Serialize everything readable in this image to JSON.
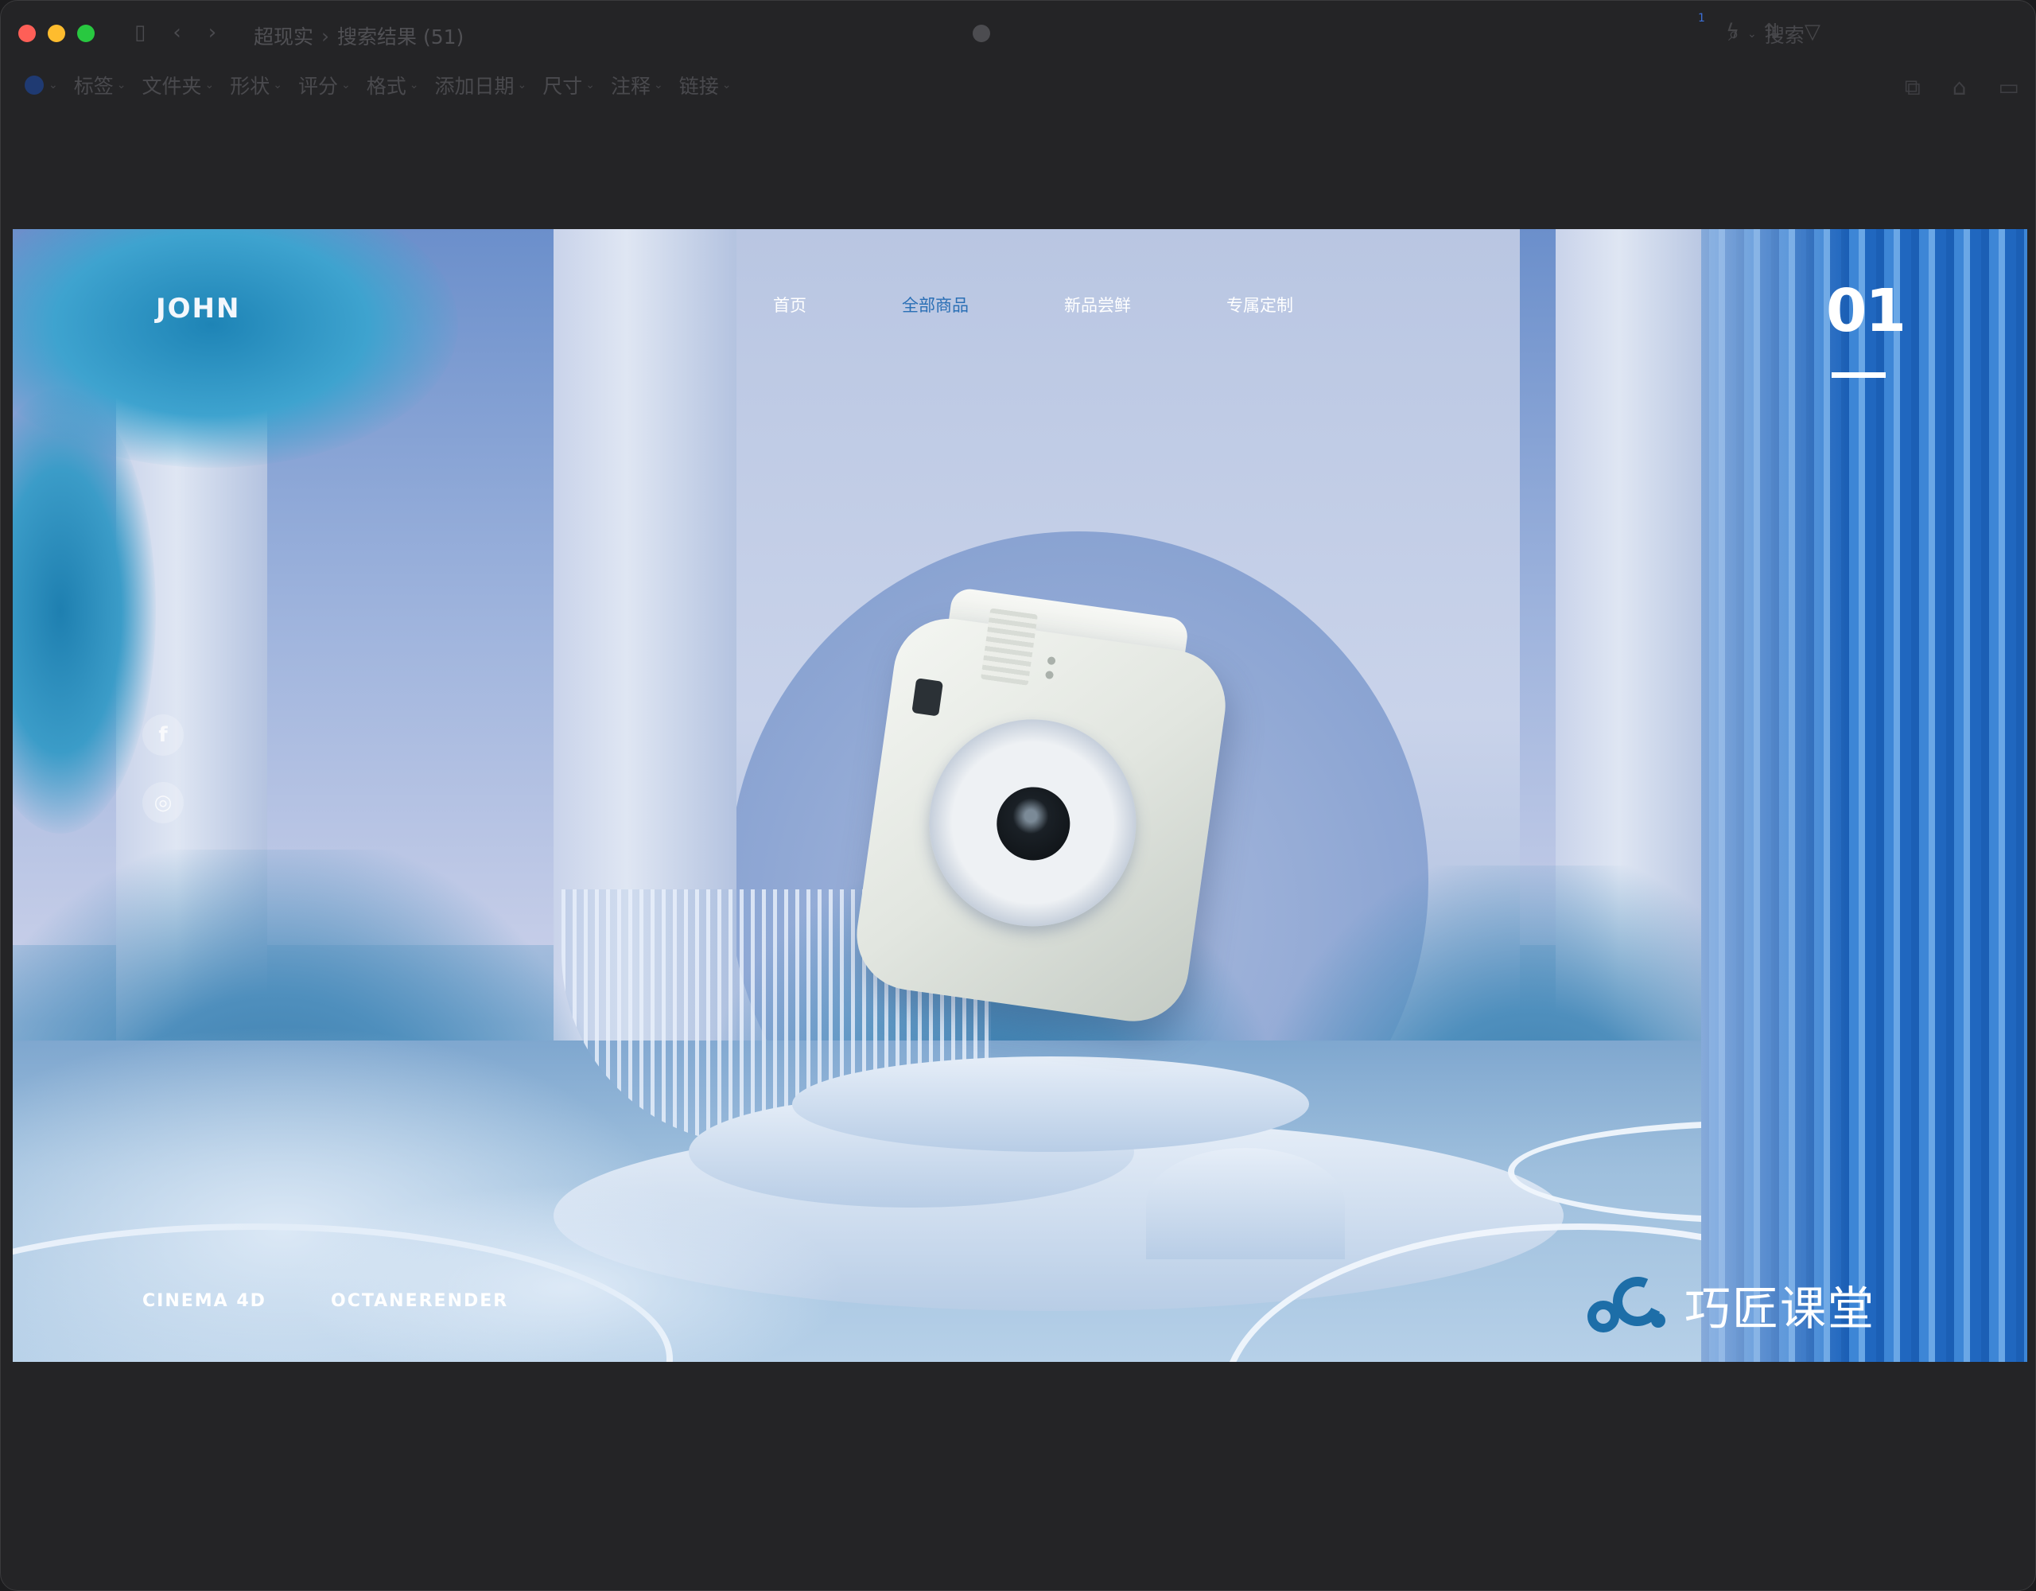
{
  "window": {
    "breadcrumb": [
      "超现实",
      "搜索结果 (51)"
    ],
    "search_placeholder": "搜索",
    "notification_count": "1"
  },
  "toolbar": {
    "filters": [
      "标签",
      "文件夹",
      "形状",
      "评分",
      "格式",
      "添加日期",
      "尺寸",
      "注释",
      "链接"
    ]
  },
  "artwork": {
    "logo": "JOHN",
    "nav": [
      "首页",
      "全部商品",
      "新品尝鲜",
      "专属定制"
    ],
    "active_nav": "全部商品",
    "page_number": "01",
    "social": [
      "f",
      "◎"
    ],
    "tags": [
      "CINEMA 4D",
      "OCTANERENDER"
    ],
    "brand_name": "巧匠课堂",
    "colors": {
      "accent": "#2a6fb5",
      "brand": "#1d6ea8",
      "curtain": "#2067bf",
      "sky": "#9fb4dd"
    }
  }
}
